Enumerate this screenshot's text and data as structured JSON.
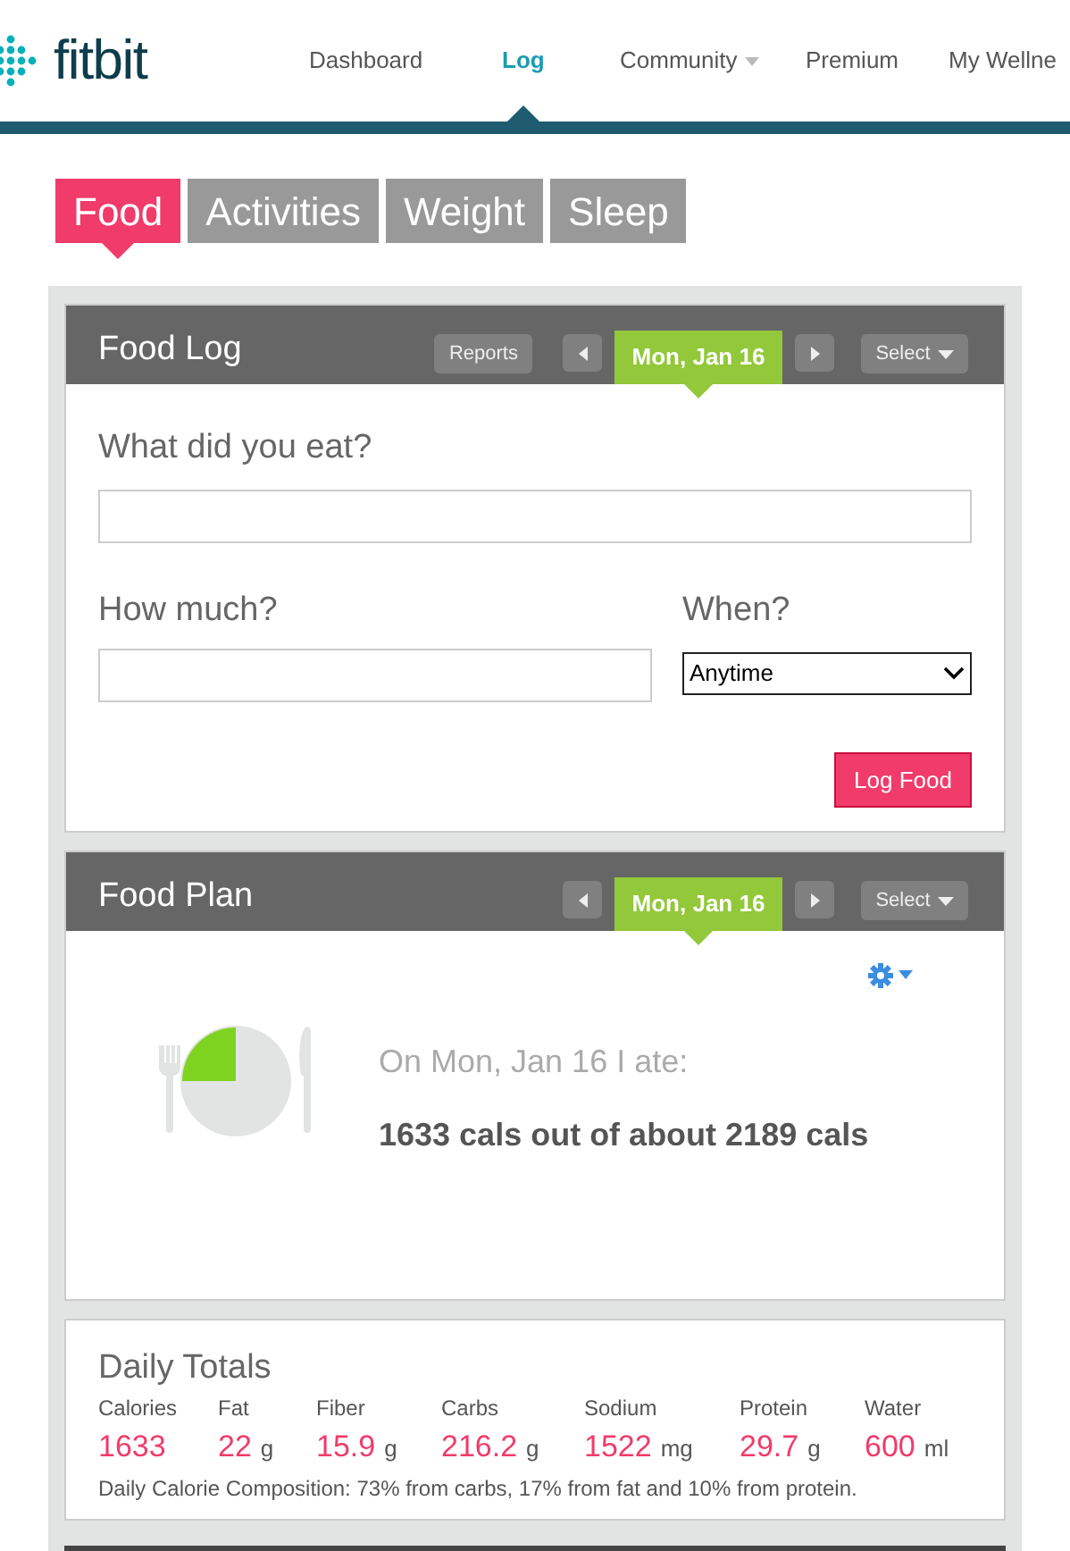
{
  "logo": {
    "text": "fitbit"
  },
  "nav": [
    {
      "label": "Dashboard",
      "selected": false,
      "dropdown": false
    },
    {
      "label": "Log",
      "selected": true,
      "dropdown": false
    },
    {
      "label": "Community",
      "selected": false,
      "dropdown": true
    },
    {
      "label": "Premium",
      "selected": false,
      "dropdown": false
    },
    {
      "label": "My Wellne",
      "selected": false,
      "dropdown": false
    }
  ],
  "tabs": [
    {
      "label": "Food",
      "selected": true
    },
    {
      "label": "Activities",
      "selected": false
    },
    {
      "label": "Weight",
      "selected": false
    },
    {
      "label": "Sleep",
      "selected": false
    }
  ],
  "food_log": {
    "title": "Food Log",
    "reports": "Reports",
    "date": "Mon, Jan 16",
    "select": "Select",
    "question": "What did you eat?",
    "how_much": "How much?",
    "when": "When?",
    "when_value": "Anytime",
    "submit": "Log Food"
  },
  "food_plan": {
    "title": "Food Plan",
    "date": "Mon, Jan 16",
    "select": "Select",
    "intro": "On Mon, Jan 16 I ate:",
    "summary": "1633 cals out of about 2189 cals"
  },
  "daily_totals": {
    "title": "Daily Totals",
    "nutrients": [
      {
        "label": "Calories",
        "value": "1633"
      },
      {
        "label": "Fat",
        "value": "22",
        "unit": "g"
      },
      {
        "label": "Fiber",
        "value": "15.9",
        "unit": "g"
      },
      {
        "label": "Carbs",
        "value": "216.2",
        "unit": "g"
      },
      {
        "label": "Sodium",
        "value": "1522",
        "unit": "mg"
      },
      {
        "label": "Protein",
        "value": "29.7",
        "unit": "g"
      },
      {
        "label": "Water",
        "value": "600",
        "unit": "ml"
      }
    ],
    "composition": "Daily Calorie Composition: 73% from carbs, 17% from fat and 10% from protein."
  }
}
